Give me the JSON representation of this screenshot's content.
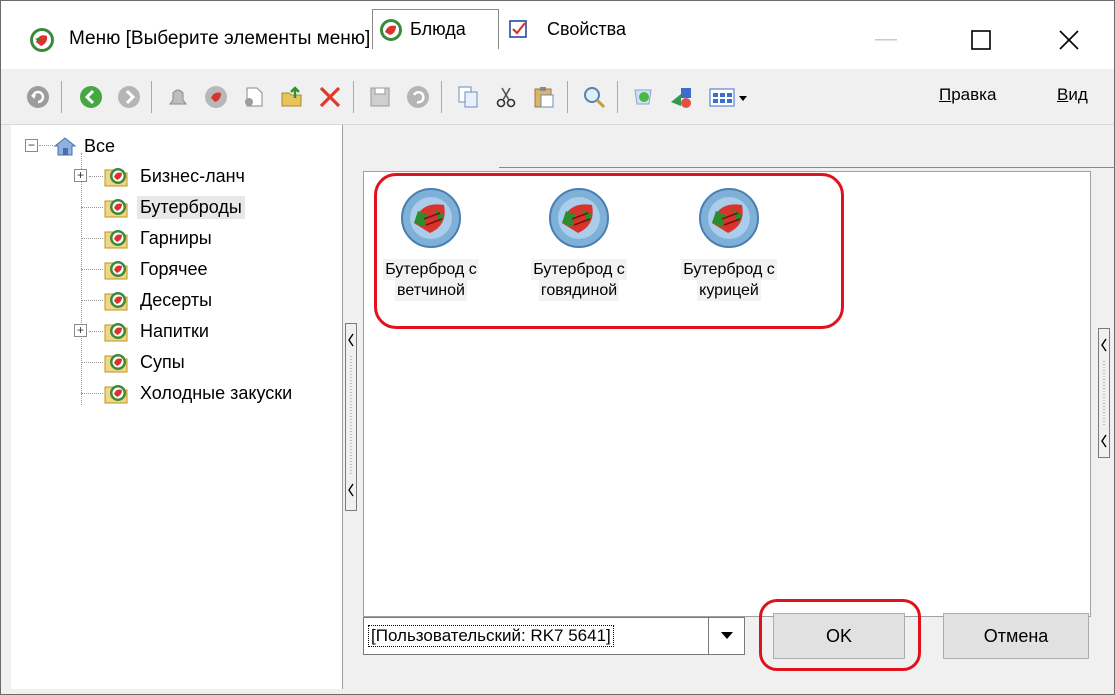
{
  "window": {
    "title": "Меню [Выберите элементы меню]"
  },
  "toolbar": {
    "menu_edit_accel": "П",
    "menu_edit_rest": "равка",
    "menu_view_accel": "В",
    "menu_view_rest": "ид",
    "icons": [
      "refresh-icon",
      "back-icon",
      "forward-icon",
      "bell-icon",
      "dish-icon",
      "new-page-icon",
      "folder-up-icon",
      "delete-icon",
      "save-icon",
      "undo-icon",
      "copy-icon",
      "cut-icon",
      "paste-icon",
      "find-icon",
      "refresh-green-icon",
      "shapes-icon",
      "grid-view-icon"
    ]
  },
  "tree": {
    "root": "Все",
    "items": [
      {
        "label": "Бизнес-ланч",
        "expandable": true
      },
      {
        "label": "Бутерброды",
        "expandable": false,
        "selected": true
      },
      {
        "label": "Гарниры",
        "expandable": false
      },
      {
        "label": "Горячее",
        "expandable": false
      },
      {
        "label": "Десерты",
        "expandable": false
      },
      {
        "label": "Напитки",
        "expandable": true
      },
      {
        "label": "Супы",
        "expandable": false
      },
      {
        "label": "Холодные закуски",
        "expandable": false
      }
    ]
  },
  "tabs": [
    {
      "label": "Блюда",
      "active": true
    },
    {
      "label": "Свойства",
      "active": false
    }
  ],
  "dishes": [
    {
      "line1": "Бутерброд с",
      "line2": "ветчиной"
    },
    {
      "line1": "Бутерброд с",
      "line2": "говядиной"
    },
    {
      "line1": "Бутерброд с",
      "line2": "курицей"
    }
  ],
  "bottom": {
    "combo_value": "[Пользовательский: RK7 5641]",
    "ok_label": "OK",
    "cancel_label": "Отмена"
  },
  "colors": {
    "highlight": "#e0131d",
    "window_bg": "#f0f0f0"
  }
}
